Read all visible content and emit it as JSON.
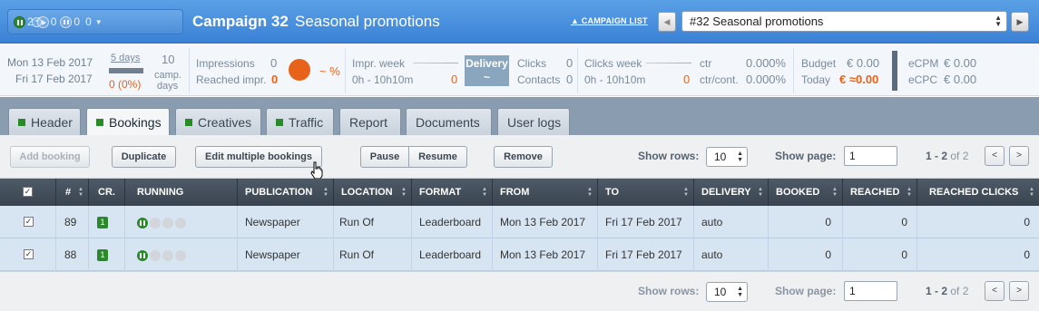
{
  "status": {
    "running": "2",
    "scheduled": "0",
    "paused": "0",
    "done": "0"
  },
  "campaign": {
    "title": "Campaign 32",
    "subtitle": "Seasonal promotions",
    "list_link": "▲ CAMPAIGN LIST",
    "selected": "#32 Seasonal promotions"
  },
  "stats": {
    "date_from": "Mon 13 Feb 2017",
    "date_to": "Fri 17 Feb 2017",
    "days_label": "5 days",
    "days_progress": "0 (0%)",
    "camp_days_value": "10",
    "camp_days_label1": "camp.",
    "camp_days_label2": "days",
    "impressions_label": "Impressions",
    "impressions_value": "0",
    "reached_label": "Reached impr.",
    "reached_value": "0",
    "pct": "~ %",
    "impr_week_label": "Impr. week",
    "impr_week_range": "0h - 10h10m",
    "impr_week_value": "0",
    "delivery_label": "Delivery",
    "delivery_value": "~",
    "clicks_label": "Clicks",
    "clicks_value": "0",
    "contacts_label": "Contacts",
    "contacts_value": "0",
    "clicks_week_label": "Clicks week",
    "clicks_week_range": "0h - 10h10m",
    "clicks_week_value": "0",
    "ctr_label": "ctr",
    "ctr_value": "0.000%",
    "ctr_cont_label": "ctr/cont.",
    "ctr_cont_value": "0.000%",
    "budget_label": "Budget",
    "budget_value": "€ 0.00",
    "today_label": "Today",
    "today_value": "€ ≈0.00",
    "ecpm_label": "eCPM",
    "ecpm_value": "€ 0.00",
    "ecpc_label": "eCPC",
    "ecpc_value": "€ 0.00"
  },
  "tabs": [
    {
      "label": "Header"
    },
    {
      "label": "Bookings"
    },
    {
      "label": "Creatives"
    },
    {
      "label": "Traffic"
    },
    {
      "label": "Report"
    },
    {
      "label": "Documents"
    },
    {
      "label": "User logs"
    }
  ],
  "toolbar": {
    "add": "Add booking",
    "duplicate": "Duplicate",
    "edit_multiple": "Edit multiple bookings",
    "pause": "Pause",
    "resume": "Resume",
    "remove": "Remove",
    "show_rows_label": "Show rows:",
    "show_rows_value": "10",
    "show_page_label": "Show page:",
    "show_page_value": "1",
    "page_range": "1 - 2",
    "page_of": "of 2",
    "prev": "<",
    "next": ">"
  },
  "columns": {
    "num": "#",
    "cr": "CR.",
    "running": "RUNNING",
    "publication": "PUBLICATION",
    "location": "LOCATION",
    "format": "FORMAT",
    "from": "FROM",
    "to": "TO",
    "delivery": "DELIVERY",
    "booked": "BOOKED",
    "reached": "REACHED",
    "reached_clicks": "REACHED CLICKS"
  },
  "rows": [
    {
      "id": "89",
      "cr": "1",
      "publication": "Newspaper",
      "location": "Run Of",
      "format": "Leaderboard",
      "from": "Mon 13 Feb 2017",
      "to": "Fri 17 Feb 2017",
      "delivery": "auto",
      "booked": "0",
      "reached": "0",
      "reached_clicks": "0"
    },
    {
      "id": "88",
      "cr": "1",
      "publication": "Newspaper",
      "location": "Run Of",
      "format": "Leaderboard",
      "from": "Mon 13 Feb 2017",
      "to": "Fri 17 Feb 2017",
      "delivery": "auto",
      "booked": "0",
      "reached": "0",
      "reached_clicks": "0"
    }
  ]
}
